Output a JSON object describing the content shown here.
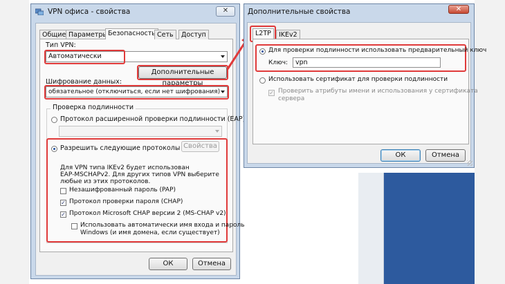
{
  "left_window": {
    "title": "VPN офиса - свойства",
    "tabs": [
      "Общие",
      "Параметры",
      "Безопасность",
      "Сеть",
      "Доступ"
    ],
    "active_tab": "Безопасность",
    "vpn_type_label": "Тип VPN:",
    "vpn_type_value": "Автоматически",
    "advanced_button": "Дополнительные параметры",
    "encryption_label": "Шифрование данных:",
    "encryption_value": "обязательное (отключиться, если нет шифрования)",
    "auth_group_label": "Проверка подлинности",
    "eap_radio": "Протокол расширенной проверки подлинности (EAP)",
    "allow_radio": "Разрешить следующие протоколы",
    "properties_button": "Свойства",
    "info_text_1": "Для VPN типа IKEv2 будет использован",
    "info_text_2": "EAP-MSCHAPv2. Для других типов VPN выберите",
    "info_text_3": "любые из этих протоколов.",
    "pap": "Незашифрованный пароль (PAP)",
    "chap": "Протокол проверки пароля (CHAP)",
    "mschap": "Протокол Microsoft CHAP версии 2 (MS-CHAP v2)",
    "auto_login_1": "Использовать автоматически имя входа и пароль",
    "auto_login_2": "Windows (и имя домена, если существует)",
    "ok": "ОК",
    "cancel": "Отмена"
  },
  "right_window": {
    "title": "Дополнительные свойства",
    "tabs": [
      "L2TP",
      "IKEv2"
    ],
    "active_tab": "L2TP",
    "psk_radio": "Для проверки подлинности использовать предварительный ключ",
    "key_label": "Ключ:",
    "key_value": "vpn",
    "cert_radio": "Использовать сертификат для проверки подлинности",
    "verify_cert_1": "Проверить атрибуты имени и использования у сертификата",
    "verify_cert_2": "сервера",
    "ok": "ОК",
    "cancel": "Отмена"
  },
  "window_controls": {
    "minimize": "–",
    "maximize": "□",
    "close": "✕"
  },
  "colors": {
    "highlight": "#e03a3a",
    "title_bar": "#c9d8ea",
    "desktop": "#2d5a9e"
  }
}
